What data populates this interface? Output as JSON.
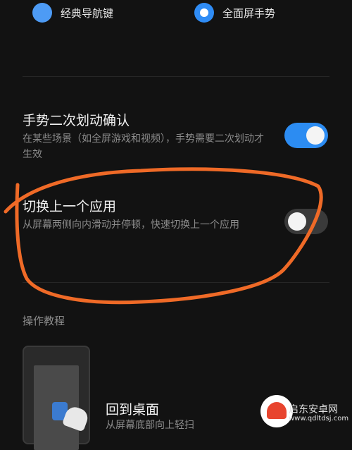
{
  "nav_mode": {
    "options": [
      {
        "label": "经典导航键",
        "selected": false
      },
      {
        "label": "全面屏手势",
        "selected": true
      }
    ]
  },
  "settings": [
    {
      "title": "手势二次划动确认",
      "desc": "在某些场景（如全屏游戏和视频），手势需要二次划动才生效",
      "enabled": true
    },
    {
      "title": "切换上一个应用",
      "desc": "从屏幕两侧向内滑动并停顿，快速切换上一个应用",
      "enabled": false
    }
  ],
  "tutorial": {
    "header": "操作教程",
    "item_title": "回到桌面",
    "item_desc": "从屏幕底部向上轻扫"
  },
  "watermark": {
    "name": "启东安卓网",
    "url": "www.qdltdsj.com"
  },
  "colors": {
    "accent": "#2f8cf5",
    "annotation": "#ef6a27"
  }
}
